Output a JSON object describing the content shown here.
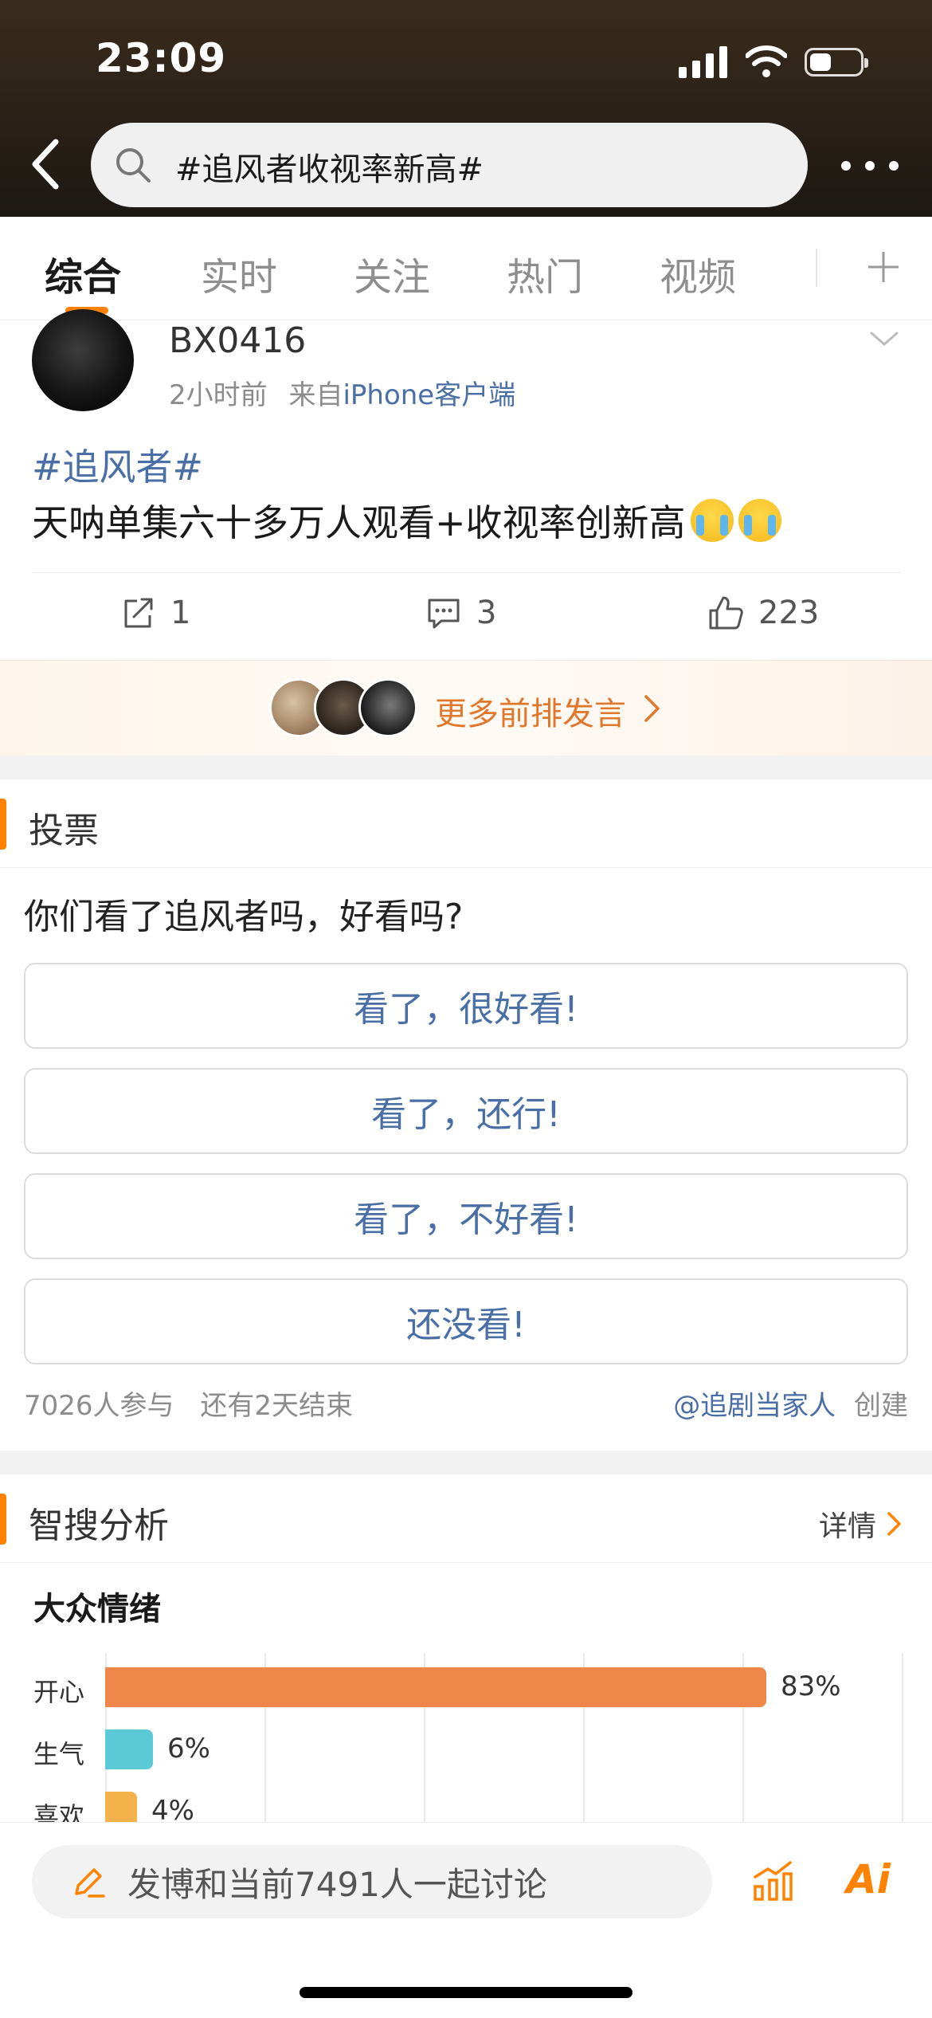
{
  "status_bar": {
    "time": "23:09"
  },
  "search": {
    "query": "#追风者收视率新高#"
  },
  "tabs": [
    {
      "label": "综合",
      "active": true
    },
    {
      "label": "实时",
      "active": false
    },
    {
      "label": "关注",
      "active": false
    },
    {
      "label": "热门",
      "active": false
    },
    {
      "label": "视频",
      "active": false
    }
  ],
  "post": {
    "username": "BX0416",
    "time": "2小时前",
    "source_prefix": "来自",
    "source_client": "iPhone客户端",
    "hashtag": "#追风者#",
    "text": "天呐单集六十多万人观看+收视率创新高",
    "emoji_count": 2,
    "reposts": "1",
    "comments": "3",
    "likes": "223"
  },
  "front_row": {
    "label": "更多前排发言"
  },
  "poll": {
    "section_title": "投票",
    "question": "你们看了追风者吗，好看吗?",
    "options": [
      "看了，很好看!",
      "看了，还行!",
      "看了，不好看!",
      "还没看!"
    ],
    "participants": "7026人参与",
    "deadline": "还有2天结束",
    "creator": "@追剧当家人",
    "creator_suffix": "创建"
  },
  "analysis": {
    "section_title": "智搜分析",
    "details_label": "详情",
    "emotion_title": "大众情绪"
  },
  "chart_data": {
    "type": "bar",
    "orientation": "horizontal",
    "title": "大众情绪",
    "categories": [
      "开心",
      "生气",
      "喜欢"
    ],
    "values": [
      83,
      6,
      4
    ],
    "value_labels": [
      "83%",
      "6%",
      "4%"
    ],
    "colors": [
      "#f0874a",
      "#5ccad6",
      "#f4b24a"
    ],
    "xlim": [
      0,
      100
    ],
    "grid": true
  },
  "bottom_bar": {
    "compose_placeholder": "发博和当前7491人一起讨论",
    "ai_label": "Ai"
  },
  "colors": {
    "accent": "#ff8200",
    "link": "#4a6ea6",
    "front_row_text": "#e0772a"
  }
}
